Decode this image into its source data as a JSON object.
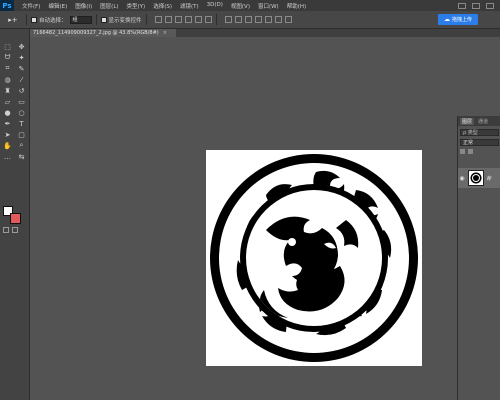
{
  "app": {
    "logo": "Ps",
    "menu": [
      "文件(F)",
      "编辑(E)",
      "图像(I)",
      "图层(L)",
      "类型(Y)",
      "选择(S)",
      "滤镜(T)",
      "3D(D)",
      "视图(V)",
      "窗口(W)",
      "帮助(H)"
    ]
  },
  "options": {
    "auto_select_label": "自动选择：",
    "auto_select_value": "组",
    "show_transform_label": "显示变换控件",
    "share_label": "拖拽上传"
  },
  "document": {
    "tab_title": "7166482_114909009327_2.jpg @ 43.8%(RGB/8#)"
  },
  "colors": {
    "foreground": "#ffffff",
    "background": "#e05a5a",
    "accent": "#2b7de9"
  },
  "layers_panel": {
    "tabs": [
      "图层",
      "通道"
    ],
    "search_placeholder": "ρ 类型",
    "blend_mode": "正常",
    "layer_name": "背"
  }
}
